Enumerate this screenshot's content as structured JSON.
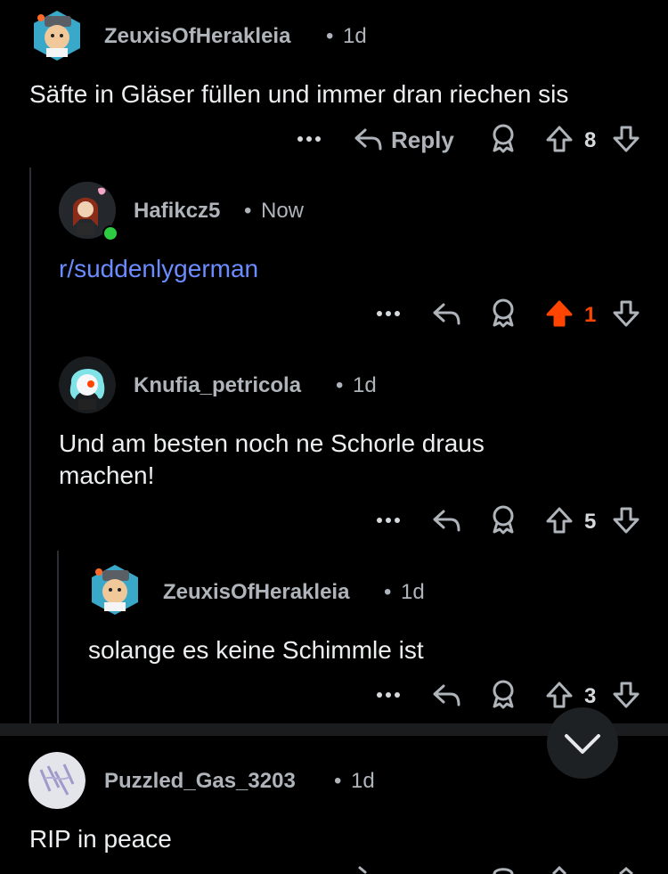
{
  "comments": [
    {
      "username": "ZeuxisOfHerakleia",
      "time": "1d",
      "text": "Säfte in Gläser füllen und immer dran riechen sis",
      "reply_label": "Reply",
      "votes": "8"
    },
    {
      "username": "Hafikcz5",
      "time": "Now",
      "text": "r/suddenlygerman",
      "votes": "1"
    },
    {
      "username": "Knufia_petricola",
      "time": "1d",
      "text_line1": "Und am besten noch ne Schorle draus",
      "text_line2": "machen!",
      "votes": "5"
    },
    {
      "username": "ZeuxisOfHerakleia",
      "time": "1d",
      "text": "solange es keine Schimmle ist",
      "votes": "3"
    },
    {
      "username": "Puzzled_Gas_3203",
      "time": "1d",
      "text": "RIP in peace"
    }
  ],
  "separator": "•",
  "colors": {
    "background": "#000000",
    "upvote_active": "#ff4500",
    "link": "#6a8cff",
    "muted": "#aeb4ba"
  }
}
